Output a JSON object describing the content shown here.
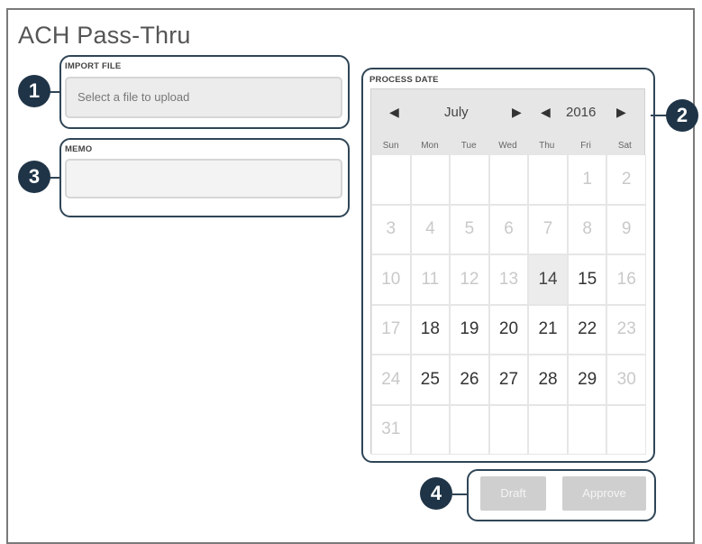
{
  "page": {
    "title": "ACH Pass-Thru"
  },
  "callouts": [
    "1",
    "2",
    "3",
    "4"
  ],
  "import_file": {
    "label": "IMPORT FILE",
    "placeholder": "Select a file to upload"
  },
  "memo": {
    "label": "MEMO",
    "value": ""
  },
  "process_date": {
    "label": "PROCESS DATE",
    "month": "July",
    "year": "2016",
    "weekdays": [
      "Sun",
      "Mon",
      "Tue",
      "Wed",
      "Thu",
      "Fri",
      "Sat"
    ],
    "days": [
      {
        "d": "",
        "s": "empty"
      },
      {
        "d": "",
        "s": "empty"
      },
      {
        "d": "",
        "s": "empty"
      },
      {
        "d": "",
        "s": "empty"
      },
      {
        "d": "",
        "s": "empty"
      },
      {
        "d": "1",
        "s": "disabled"
      },
      {
        "d": "2",
        "s": "disabled"
      },
      {
        "d": "3",
        "s": "disabled"
      },
      {
        "d": "4",
        "s": "disabled"
      },
      {
        "d": "5",
        "s": "disabled"
      },
      {
        "d": "6",
        "s": "disabled"
      },
      {
        "d": "7",
        "s": "disabled"
      },
      {
        "d": "8",
        "s": "disabled"
      },
      {
        "d": "9",
        "s": "disabled"
      },
      {
        "d": "10",
        "s": "disabled"
      },
      {
        "d": "11",
        "s": "disabled"
      },
      {
        "d": "12",
        "s": "disabled"
      },
      {
        "d": "13",
        "s": "disabled"
      },
      {
        "d": "14",
        "s": "today"
      },
      {
        "d": "15",
        "s": "active"
      },
      {
        "d": "16",
        "s": "disabled"
      },
      {
        "d": "17",
        "s": "disabled"
      },
      {
        "d": "18",
        "s": "active"
      },
      {
        "d": "19",
        "s": "active"
      },
      {
        "d": "20",
        "s": "active"
      },
      {
        "d": "21",
        "s": "active"
      },
      {
        "d": "22",
        "s": "active"
      },
      {
        "d": "23",
        "s": "disabled"
      },
      {
        "d": "24",
        "s": "disabled"
      },
      {
        "d": "25",
        "s": "active"
      },
      {
        "d": "26",
        "s": "active"
      },
      {
        "d": "27",
        "s": "active"
      },
      {
        "d": "28",
        "s": "active"
      },
      {
        "d": "29",
        "s": "active"
      },
      {
        "d": "30",
        "s": "disabled"
      },
      {
        "d": "31",
        "s": "disabled"
      },
      {
        "d": "",
        "s": "empty"
      },
      {
        "d": "",
        "s": "empty"
      },
      {
        "d": "",
        "s": "empty"
      },
      {
        "d": "",
        "s": "empty"
      },
      {
        "d": "",
        "s": "empty"
      },
      {
        "d": "",
        "s": "empty"
      }
    ]
  },
  "actions": {
    "draft_label": "Draft",
    "approve_label": "Approve"
  },
  "colors": {
    "badge": "#1f3447",
    "callout_border": "#2f4556",
    "button_disabled": "#cfcfcf"
  }
}
